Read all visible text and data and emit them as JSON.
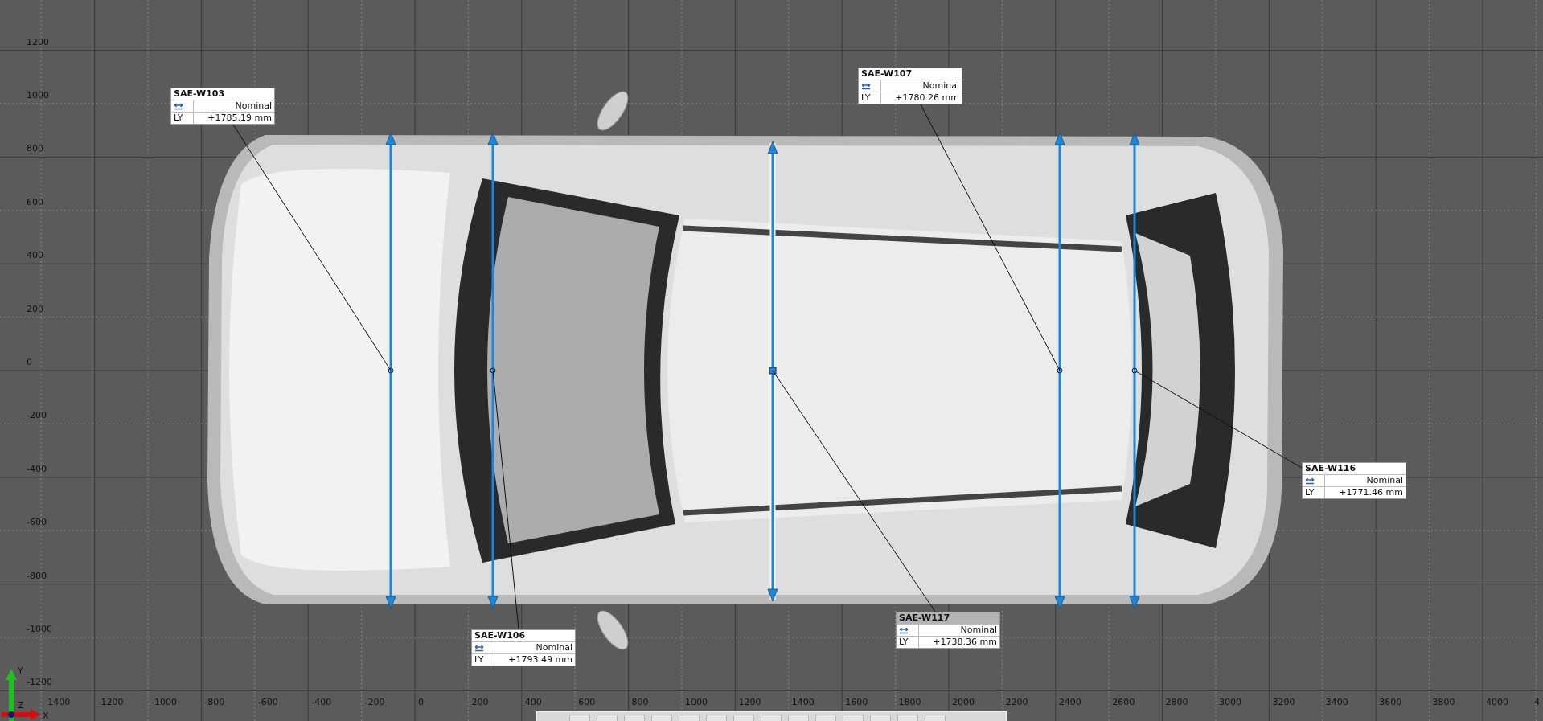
{
  "viewport": {
    "y_axis_labels": [
      "1200",
      "1000",
      "800",
      "600",
      "400",
      "200",
      "0",
      "-200",
      "-400",
      "-600",
      "-800",
      "-1000",
      "-1200"
    ],
    "x_axis_labels": [
      "-1400",
      "-1200",
      "-1000",
      "-800",
      "-600",
      "-400",
      "-200",
      "0",
      "200",
      "400",
      "600",
      "800",
      "1000",
      "1200",
      "1400",
      "1600",
      "1800",
      "2000",
      "2200",
      "2400",
      "2600",
      "2800",
      "3000",
      "3200",
      "3400",
      "3600",
      "3800",
      "4000",
      "4"
    ],
    "triad": {
      "x": "X",
      "y": "Y",
      "z": "Z"
    }
  },
  "measurements": [
    {
      "name": "SAE-W103",
      "status": "Nominal",
      "axis": "LY",
      "value": "+1785.19 mm",
      "highlighted": false
    },
    {
      "name": "SAE-W107",
      "status": "Nominal",
      "axis": "LY",
      "value": "+1780.26 mm",
      "highlighted": false
    },
    {
      "name": "SAE-W116",
      "status": "Nominal",
      "axis": "LY",
      "value": "+1771.46 mm",
      "highlighted": false
    },
    {
      "name": "SAE-W106",
      "status": "Nominal",
      "axis": "LY",
      "value": "+1793.49 mm",
      "highlighted": false
    },
    {
      "name": "SAE-W117",
      "status": "Nominal",
      "axis": "LY",
      "value": "+1738.36 mm",
      "highlighted": true
    }
  ]
}
